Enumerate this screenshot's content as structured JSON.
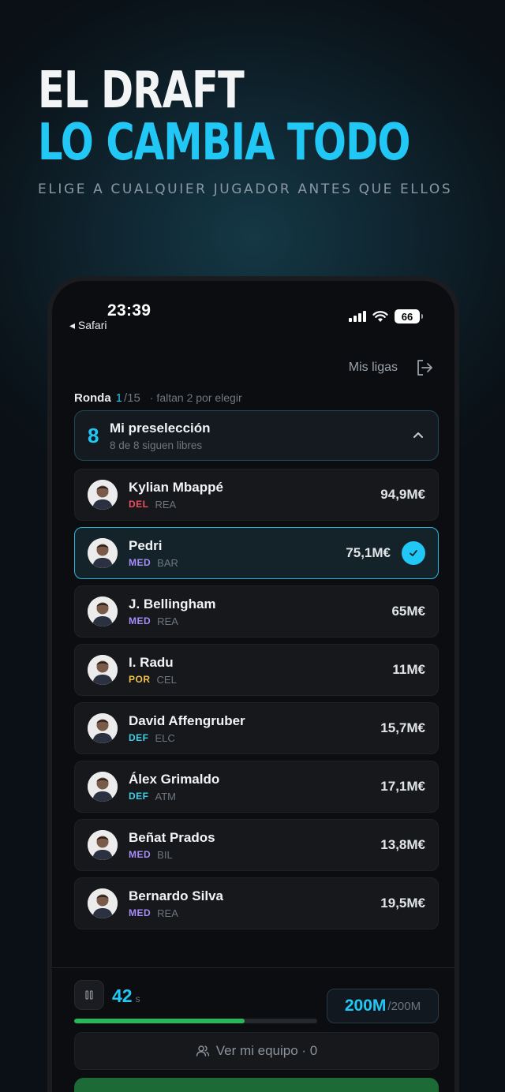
{
  "hero": {
    "line1": "EL DRAFT",
    "line2": "LO CAMBIA TODO",
    "subtitle": "ELIGE A CUALQUIER JUGADOR ANTES QUE ELLOS"
  },
  "status_bar": {
    "time": "23:39",
    "back_label": "◂ Safari",
    "battery": "66"
  },
  "topbar": {
    "my_leagues": "Mis ligas"
  },
  "round": {
    "label": "Ronda",
    "current": "1",
    "total": "/15",
    "remaining": "· faltan 2 por elegir"
  },
  "preselection": {
    "count": "8",
    "title": "Mi preselección",
    "subtitle": "8 de 8 siguen libres"
  },
  "players": [
    {
      "name": "Kylian Mbappé",
      "position": "DEL",
      "team": "REA",
      "price": "94,9M€",
      "selected": false
    },
    {
      "name": "Pedri",
      "position": "MED",
      "team": "BAR",
      "price": "75,1M€",
      "selected": true
    },
    {
      "name": "J. Bellingham",
      "position": "MED",
      "team": "REA",
      "price": "65M€",
      "selected": false
    },
    {
      "name": "I. Radu",
      "position": "POR",
      "team": "CEL",
      "price": "11M€",
      "selected": false
    },
    {
      "name": "David Affengruber",
      "position": "DEF",
      "team": "ELC",
      "price": "15,7M€",
      "selected": false
    },
    {
      "name": "Álex Grimaldo",
      "position": "DEF",
      "team": "ATM",
      "price": "17,1M€",
      "selected": false
    },
    {
      "name": "Beñat Prados",
      "position": "MED",
      "team": "BIL",
      "price": "13,8M€",
      "selected": false
    },
    {
      "name": "Bernardo Silva",
      "position": "MED",
      "team": "REA",
      "price": "19,5M€",
      "selected": false
    }
  ],
  "footer": {
    "timer_value": "42",
    "timer_unit": "s",
    "timer_progress_fraction": 0.7,
    "budget_amount": "200M",
    "budget_total": "/200M",
    "team_button": "Ver mi equipo · 0"
  },
  "colors": {
    "accent": "#22c8f5",
    "progress": "#27b85a",
    "pos_DEL": "#f04f5f",
    "pos_MED": "#a88cf8",
    "pos_POR": "#f2c14a",
    "pos_DEF": "#3fd0e8"
  },
  "icons": {
    "logout": "logout-icon",
    "chevron": "chevron-up-icon",
    "check": "check-icon",
    "pause": "pause-icon",
    "team": "users-icon"
  }
}
